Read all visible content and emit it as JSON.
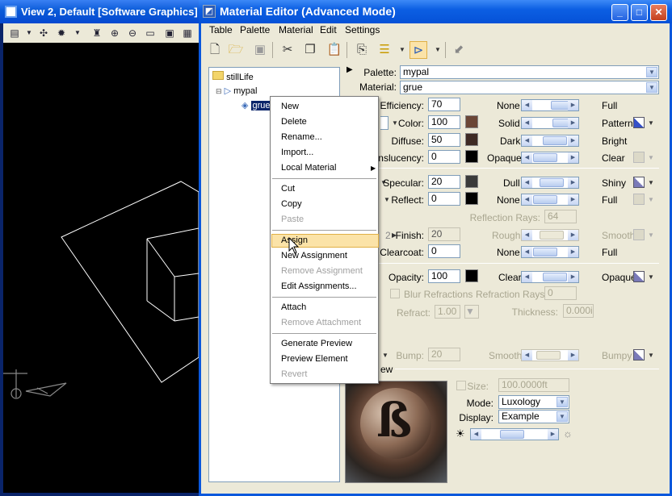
{
  "view_window": {
    "title": "View 2, Default [Software Graphics]"
  },
  "editor": {
    "title": "Material Editor (Advanced Mode)",
    "menu": [
      "Table",
      "Palette",
      "Material",
      "Edit",
      "Settings"
    ],
    "palette_label": "Palette:",
    "palette_value": "mypal",
    "material_label": "Material:",
    "material_value": "grue",
    "tree": {
      "root": "stillLife",
      "palette": "mypal",
      "material": "grue"
    },
    "props": {
      "efficiency": {
        "label": "Efficiency:",
        "value": "70",
        "left": "None",
        "right": "Full"
      },
      "color": {
        "label": "Color:",
        "value": "100",
        "left": "Solid",
        "right": "Pattern"
      },
      "diffuse": {
        "label": "Diffuse:",
        "value": "50",
        "left": "Dark",
        "right": "Bright"
      },
      "translucency": {
        "label": "anslucency:",
        "value": "0",
        "left": "Opaque",
        "right": "Clear"
      },
      "specular": {
        "label": "Specular:",
        "value": "20",
        "left": "Dull",
        "right": "Shiny"
      },
      "reflect": {
        "label": "Reflect:",
        "value": "0",
        "left": "None",
        "right": "Full"
      },
      "reflection_rays": {
        "label": "Reflection Rays:",
        "value": "64"
      },
      "finish": {
        "label": "Finish:",
        "value": "20",
        "left": "Rough",
        "right": "Smooth"
      },
      "clearcoat": {
        "label": "Clearcoat:",
        "value": "0",
        "left": "None",
        "right": "Full"
      },
      "opacity": {
        "label": "Opacity:",
        "value": "100",
        "left": "Clear",
        "right": "Opaque"
      },
      "blur_refractions": "Blur Refractions",
      "refraction_rays": {
        "label": "Refraction Rays:",
        "value": "0"
      },
      "refract": {
        "label": "Refract:",
        "value": "1.00"
      },
      "thickness": {
        "label": "Thickness:",
        "value": "0.000i"
      },
      "bump": {
        "label": "Bump:",
        "value": "20",
        "left": "Smooth",
        "right": "Bumpy"
      }
    },
    "preview_header": "ew",
    "size": {
      "label": "Size:",
      "value": "100.0000ft"
    },
    "mode": {
      "label": "Mode:",
      "value": "Luxology"
    },
    "display": {
      "label": "Display:",
      "value": "Example"
    }
  },
  "context_menu": {
    "items": [
      {
        "label": "New",
        "enabled": true
      },
      {
        "label": "Delete",
        "enabled": true
      },
      {
        "label": "Rename...",
        "enabled": true
      },
      {
        "label": "Import...",
        "enabled": true
      },
      {
        "label": "Local Material",
        "enabled": true
      },
      {
        "label": "Cut",
        "enabled": true
      },
      {
        "label": "Copy",
        "enabled": true
      },
      {
        "label": "Paste",
        "enabled": false
      },
      {
        "label": "Assign",
        "enabled": true
      },
      {
        "label": "New Assignment",
        "enabled": true
      },
      {
        "label": "Remove Assignment",
        "enabled": false
      },
      {
        "label": "Edit Assignments...",
        "enabled": true
      },
      {
        "label": "Attach",
        "enabled": true
      },
      {
        "label": "Remove Attachment",
        "enabled": false
      },
      {
        "label": "Generate Preview",
        "enabled": true
      },
      {
        "label": "Preview Element",
        "enabled": true
      },
      {
        "label": "Revert",
        "enabled": false
      }
    ]
  },
  "colors": {
    "titlebar_blue": "#0a5bd8",
    "menu_highlight": "#fbe3a8",
    "window_bg": "#ece9d8"
  }
}
